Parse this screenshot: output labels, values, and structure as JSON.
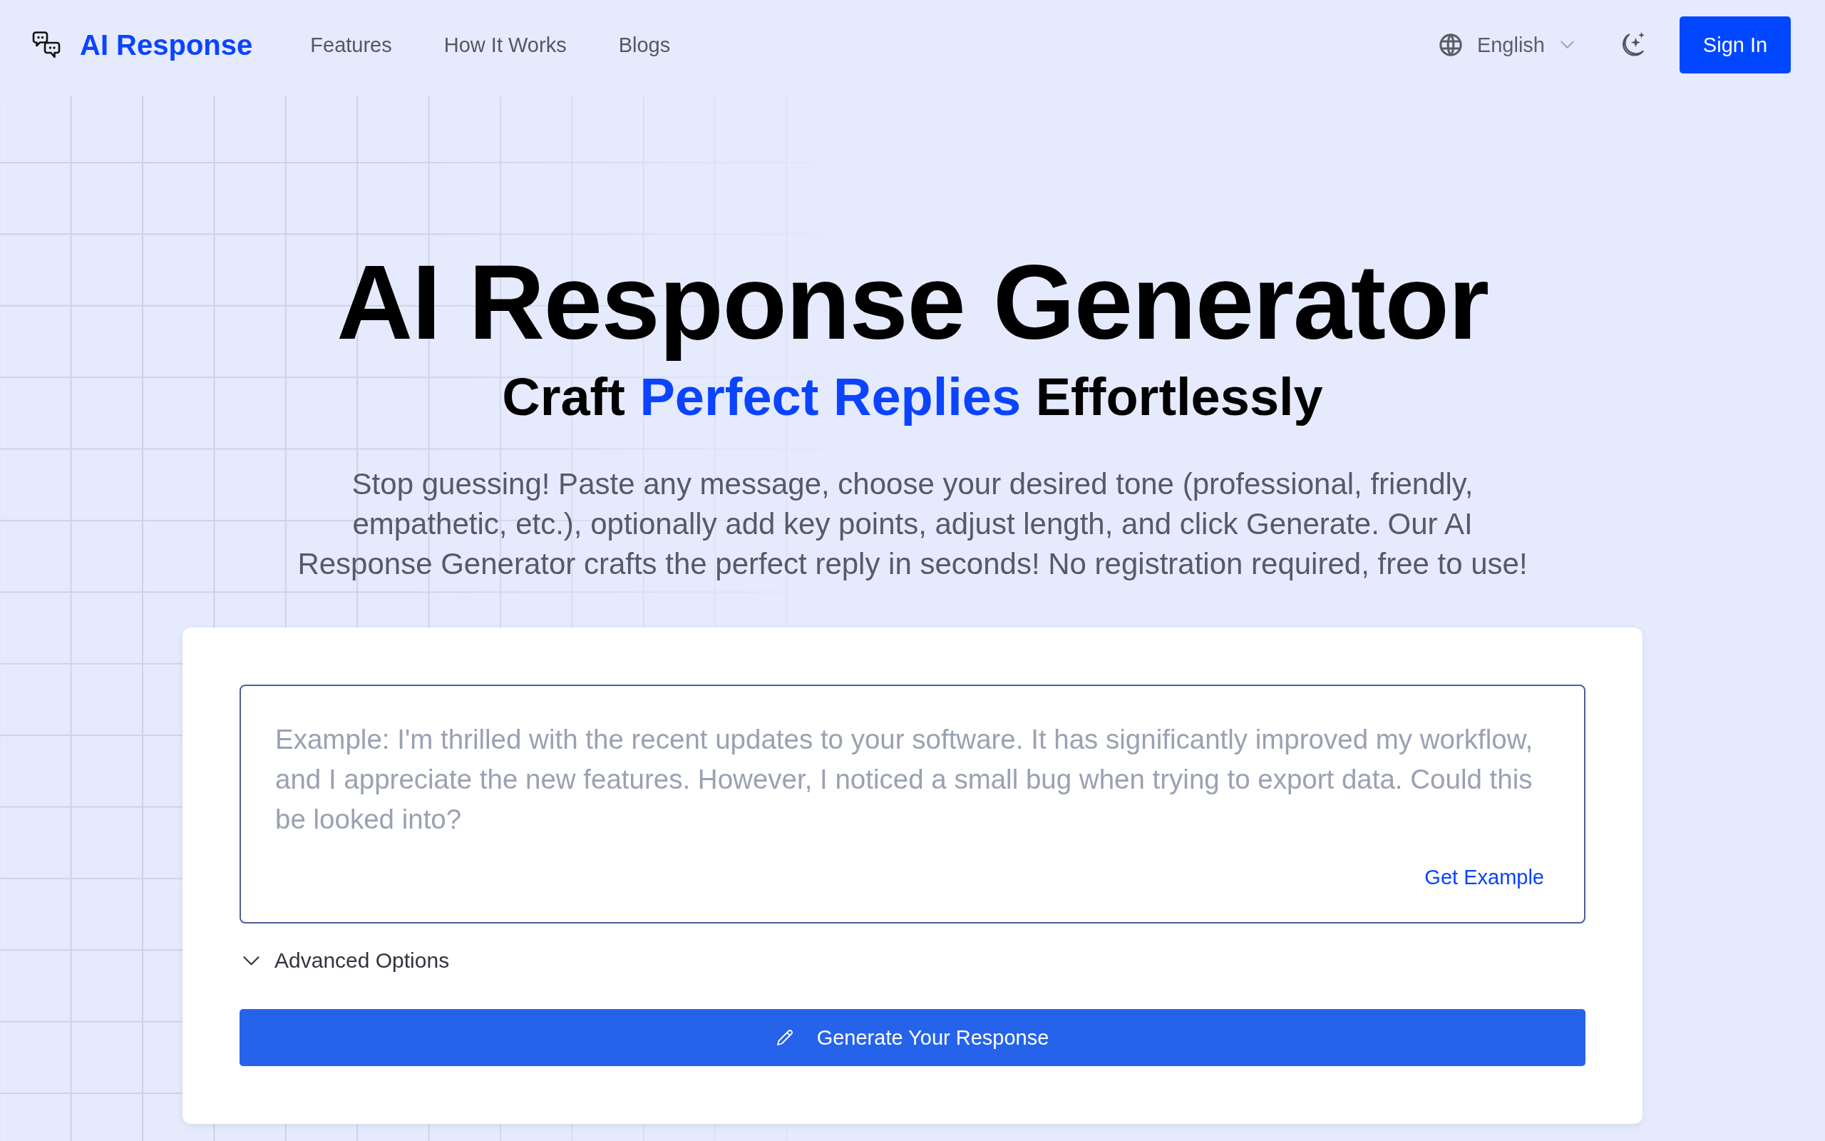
{
  "header": {
    "logo": "AI Response",
    "nav": [
      {
        "label": "Features"
      },
      {
        "label": "How It Works"
      },
      {
        "label": "Blogs"
      }
    ],
    "language": {
      "value": "English"
    },
    "sign_in": "Sign In"
  },
  "hero": {
    "title": "AI Response Generator",
    "subtitle": [
      {
        "text": "Craft",
        "kind": "plain"
      },
      {
        "text": "Perfect Replies",
        "kind": "accent"
      },
      {
        "text": "Effortlessly",
        "kind": "plain"
      }
    ],
    "description": "Stop guessing! Paste any message, choose your desired tone (professional, friendly, empathetic, etc.), optionally add key points, adjust length, and click Generate. Our AI Response Generator crafts the perfect reply in seconds! No registration required, free to use!"
  },
  "form": {
    "message": {
      "placeholder": "Example: I'm thrilled with the recent updates to your software. It has significantly improved my workflow, and I appreciate the new features. However, I noticed a small bug when trying to export data. Could this be looked into?"
    },
    "get_example": "Get Example",
    "advanced_options": {
      "label": "Advanced Options",
      "expanded": false
    },
    "generate_button": "Generate Your Response"
  }
}
